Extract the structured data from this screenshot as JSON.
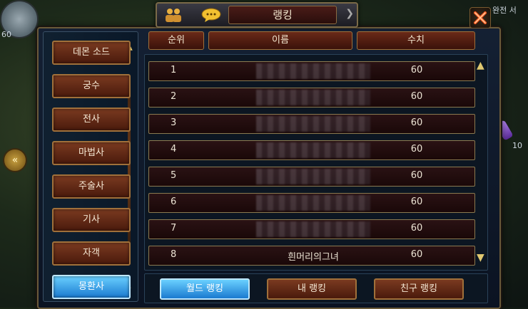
{
  "titlebar": {
    "title": "랭킹",
    "friend_icon": "friends-icon",
    "chat_icon": "chat-icon",
    "close_icon": "close-icon"
  },
  "hud": {
    "left_level": "60",
    "right_count": "10",
    "top_right_text": "완전 서"
  },
  "classes": [
    {
      "label": "데몬 소드",
      "active": false
    },
    {
      "label": "궁수",
      "active": false
    },
    {
      "label": "전사",
      "active": false
    },
    {
      "label": "마법사",
      "active": false
    },
    {
      "label": "주술사",
      "active": false
    },
    {
      "label": "기사",
      "active": false
    },
    {
      "label": "자객",
      "active": false
    },
    {
      "label": "몽환사",
      "active": true
    }
  ],
  "table": {
    "headers": {
      "rank": "순위",
      "name": "이름",
      "value": "수치"
    },
    "rows": [
      {
        "rank": "1",
        "name": "",
        "value": "60",
        "name_hidden": true
      },
      {
        "rank": "2",
        "name": "",
        "value": "60",
        "name_hidden": true
      },
      {
        "rank": "3",
        "name": "",
        "value": "60",
        "name_hidden": true
      },
      {
        "rank": "4",
        "name": "",
        "value": "60",
        "name_hidden": true
      },
      {
        "rank": "5",
        "name": "",
        "value": "60",
        "name_hidden": true
      },
      {
        "rank": "6",
        "name": "",
        "value": "60",
        "name_hidden": true
      },
      {
        "rank": "7",
        "name": "",
        "value": "60",
        "name_hidden": true
      },
      {
        "rank": "8",
        "name": "흰머리의그녀",
        "value": "60",
        "name_hidden": false
      }
    ]
  },
  "tabs": [
    {
      "label": "월드 랭킹",
      "active": true
    },
    {
      "label": "내 랭킹",
      "active": false
    },
    {
      "label": "친구 랭킹",
      "active": false
    }
  ],
  "colors": {
    "accent_active": "#1a7ad0",
    "button_brown": "#4a1a0c",
    "border_gold": "#a0703a"
  }
}
